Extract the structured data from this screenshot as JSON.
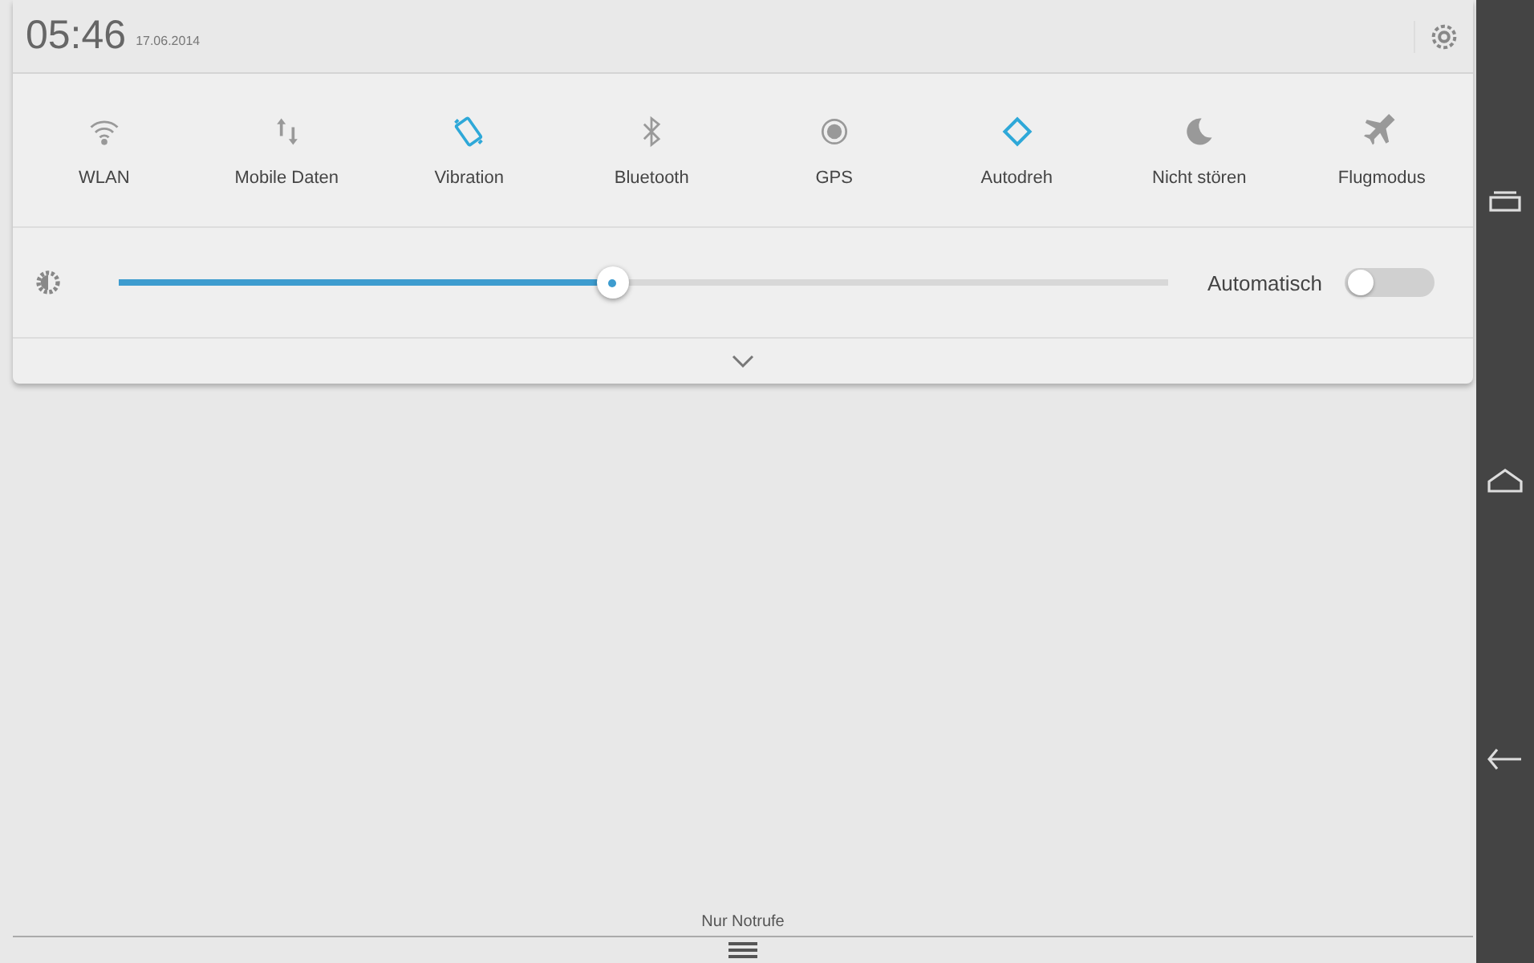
{
  "header": {
    "time": "05:46",
    "date": "17.06.2014"
  },
  "tiles": [
    {
      "kind": "wifi",
      "label": "WLAN",
      "on": false
    },
    {
      "kind": "data",
      "label": "Mobile Daten",
      "on": false
    },
    {
      "kind": "vibration",
      "label": "Vibration",
      "on": true
    },
    {
      "kind": "bluetooth",
      "label": "Bluetooth",
      "on": false
    },
    {
      "kind": "gps",
      "label": "GPS",
      "on": false
    },
    {
      "kind": "rotate",
      "label": "Autodreh",
      "on": true
    },
    {
      "kind": "moon",
      "label": "Nicht stören",
      "on": false
    },
    {
      "kind": "plane",
      "label": "Flugmodus",
      "on": false
    }
  ],
  "brightness": {
    "level": 0.47,
    "auto_label": "Automatisch",
    "auto_on": false
  },
  "footer": {
    "status": "Nur Notrufe"
  }
}
